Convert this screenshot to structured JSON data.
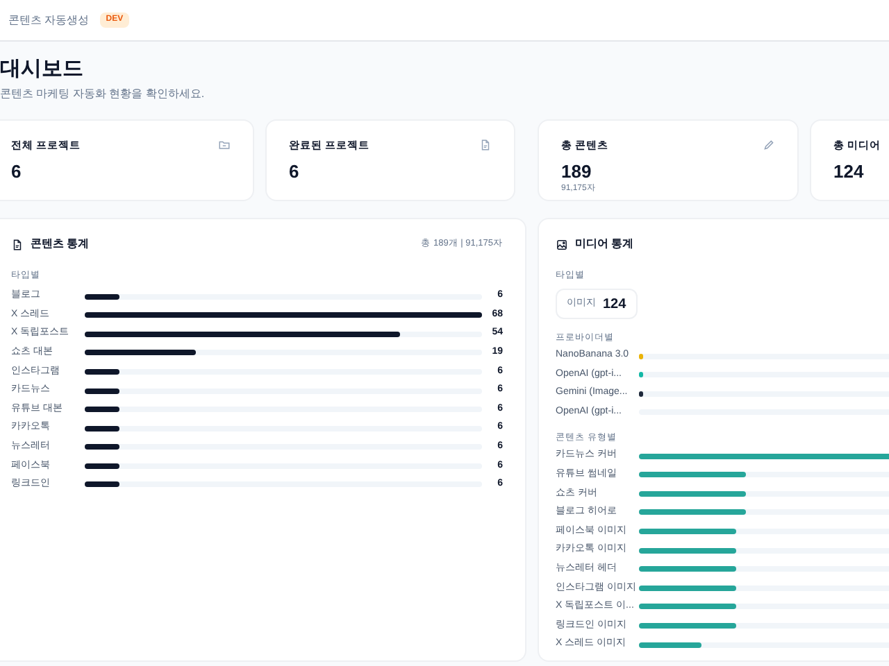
{
  "header": {
    "app_name": "콘텐츠 자동생성",
    "badge": "DEV"
  },
  "page": {
    "title": "대시보드",
    "subtitle": "콘텐츠 마케팅 자동화 현황을 확인하세요."
  },
  "stat_cards": [
    {
      "label": "전체 프로젝트",
      "value": "6"
    },
    {
      "label": "완료된 프로젝트",
      "value": "6"
    },
    {
      "label": "총 콘텐츠",
      "value": "189",
      "sub": "91,175자"
    },
    {
      "label": "총 미디어",
      "value": "124"
    }
  ],
  "content_stats": {
    "title": "콘텐츠 통계",
    "summary": "총 189개 | 91,175자",
    "section": "타입별",
    "rows": [
      {
        "label": "블로그",
        "value": "6",
        "level": 0.088
      },
      {
        "label": "X 스레드",
        "value": "68",
        "level": 1
      },
      {
        "label": "X 독립포스트",
        "value": "54",
        "level": 0.794
      },
      {
        "label": "쇼츠 대본",
        "value": "19",
        "level": 0.279
      },
      {
        "label": "인스타그램",
        "value": "6",
        "level": 0.088
      },
      {
        "label": "카드뉴스",
        "value": "6",
        "level": 0.088
      },
      {
        "label": "유튜브 대본",
        "value": "6",
        "level": 0.088
      },
      {
        "label": "카카오톡",
        "value": "6",
        "level": 0.088
      },
      {
        "label": "뉴스레터",
        "value": "6",
        "level": 0.088
      },
      {
        "label": "페이스북",
        "value": "6",
        "level": 0.088
      },
      {
        "label": "링크드인",
        "value": "6",
        "level": 0.088
      }
    ]
  },
  "media_stats": {
    "title": "미디어 통계",
    "type_section": "타입별",
    "type_label": "이미지",
    "type_value": "124",
    "provider_section": "프로바이더별",
    "providers": [
      {
        "label": "NanoBanana 3.0",
        "level": 0.01,
        "color": "#eab308"
      },
      {
        "label": "OpenAI (gpt-i...",
        "level": 0.01,
        "color": "#14b8a6"
      },
      {
        "label": "Gemini (Image...",
        "level": 0.01,
        "color": "#1e293b"
      },
      {
        "label": "OpenAI (gpt-i..."
      }
    ],
    "category_section": "콘텐츠 유형별",
    "categories": [
      {
        "label": "카드뉴스 커버",
        "level": 1
      },
      {
        "label": "유튜브 썸네일",
        "level": 0.34
      },
      {
        "label": "쇼츠 커버",
        "level": 0.34
      },
      {
        "label": "블로그 히어로",
        "level": 0.34
      },
      {
        "label": "페이스북 이미지",
        "level": 0.31
      },
      {
        "label": "카카오톡 이미지",
        "level": 0.31
      },
      {
        "label": "뉴스레터 헤더",
        "level": 0.31
      },
      {
        "label": "인스타그램 이미지",
        "level": 0.31
      },
      {
        "label": "X 독립포스트 이...",
        "level": 0.31
      },
      {
        "label": "링크드인 이미지",
        "level": 0.31
      },
      {
        "label": "X 스레드 이미지",
        "level": 0.2
      }
    ]
  }
}
